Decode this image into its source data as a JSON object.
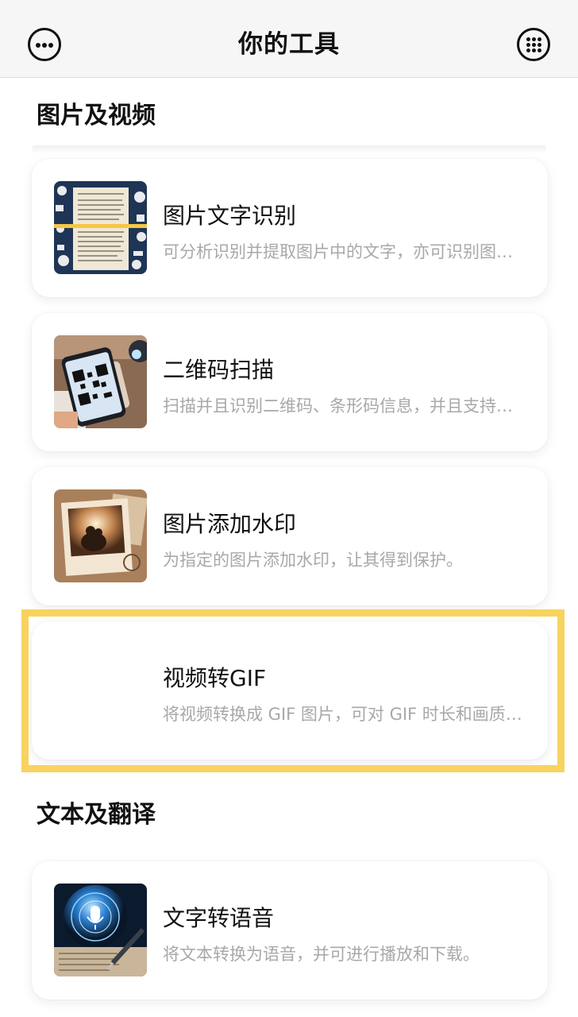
{
  "header": {
    "title": "你的工具"
  },
  "sections": [
    {
      "title": "图片及视频",
      "tools": [
        {
          "name": "图片文字识别",
          "desc": "可分析识别并提取图片中的文字，亦可识别图片中的各种文字信息"
        },
        {
          "name": "二维码扫描",
          "desc": "扫描并且识别二维码、条形码信息，并且支持生成二维码"
        },
        {
          "name": "图片添加水印",
          "desc": "为指定的图片添加水印，让其得到保护。"
        },
        {
          "name": "视频转GIF",
          "desc": "将视频转换成 GIF 图片，可对 GIF 时长和画质进行设置"
        }
      ]
    },
    {
      "title": "文本及翻译",
      "tools": [
        {
          "name": "文字转语音",
          "desc": "将文本转换为语音，并可进行播放和下载。"
        }
      ]
    }
  ],
  "colors": {
    "highlight": "#f8d35e",
    "header_bg": "#f6f6f6",
    "desc_text": "#a8a8a8"
  },
  "icons": {
    "left": "more-icon",
    "right": "grid-menu-icon"
  }
}
